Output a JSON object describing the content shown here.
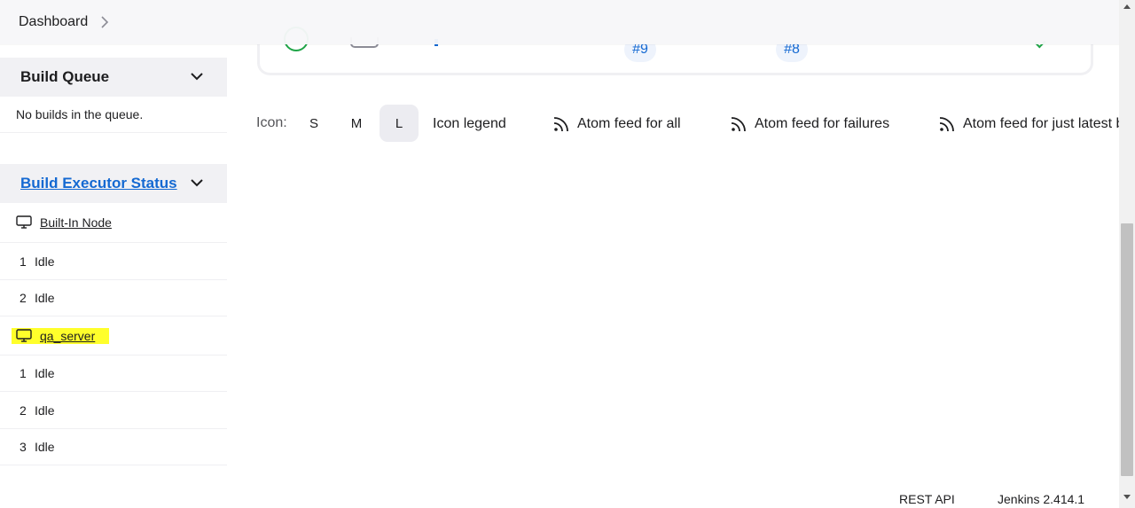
{
  "breadcrumb": {
    "dashboard": "Dashboard"
  },
  "build_card": {
    "badges": [
      "#9",
      "#8"
    ]
  },
  "build_queue": {
    "title": "Build Queue",
    "empty_text": "No builds in the queue."
  },
  "executor_status": {
    "title": "Build Executor Status",
    "nodes": [
      {
        "name": "Built-In Node",
        "executors": [
          {
            "num": "1",
            "state": "Idle"
          },
          {
            "num": "2",
            "state": "Idle"
          }
        ]
      },
      {
        "name": "qa_server",
        "executors": [
          {
            "num": "1",
            "state": "Idle"
          },
          {
            "num": "2",
            "state": "Idle"
          },
          {
            "num": "3",
            "state": "Idle"
          }
        ]
      }
    ]
  },
  "icon_bar": {
    "label": "Icon:",
    "sizes": [
      "S",
      "M",
      "L"
    ],
    "selected_size": "L",
    "legend": "Icon legend",
    "feeds": [
      "Atom feed for all",
      "Atom feed for failures",
      "Atom feed for just latest builds"
    ]
  },
  "footer": {
    "rest_api": "REST API",
    "version": "Jenkins 2.414.1"
  },
  "colors": {
    "link": "#1469d2",
    "highlight": "#ffff2b",
    "success": "#1ea446",
    "panel_bg": "#f1f1f4"
  }
}
